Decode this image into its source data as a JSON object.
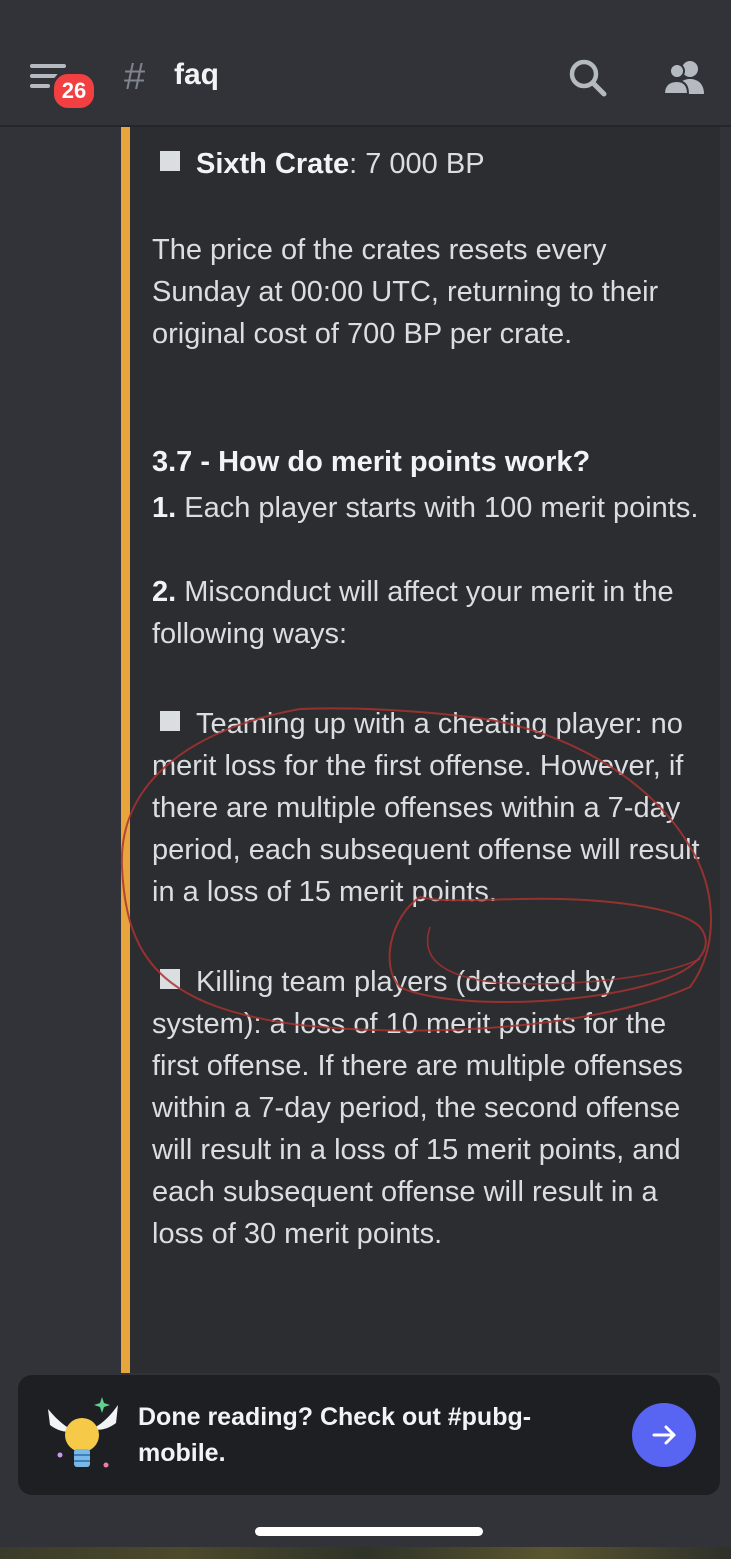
{
  "header": {
    "unread_count": "26",
    "hash_symbol": "#",
    "channel_name": "faq",
    "icons": [
      "menu-icon",
      "search-icon",
      "members-icon"
    ]
  },
  "content": {
    "sixth_crate_label": "Sixth Crate",
    "sixth_crate_value": ": 7 000 BP",
    "reset_text": "The price of the crates resets every Sunday at 00:00 UTC, returning to their original cost of 700 BP per crate.",
    "section_heading": "3.7 - How do merit points work?",
    "point1_num": "1.",
    "point1_text": " Each player starts with 100 merit points.",
    "point2_num": "2.",
    "point2_text": " Misconduct will affect your merit in the following ways:",
    "bullet_teaming": "Teaming up with a cheating player: no merit loss for the first offense. However, if there are multiple offenses within a 7-day period, each subsequent offense will result in a loss of 15 merit points.",
    "bullet_killing": "Killing team players (detected by system): a loss of 10 merit points for the first offense. If there are multiple offenses within a 7-day period, the second offense will result in a loss of 15 merit points, and each subsequent offense will result in a loss of 30 merit points."
  },
  "bottom_card": {
    "text": "Done reading? Check out #pubg-mobile.",
    "button_icon": "arrow-right-icon",
    "mascot_icon": "winged-lightbulb-icon"
  },
  "colors": {
    "background": "#313338",
    "embed_bg": "#2b2d31",
    "embed_accent": "#e8a53d",
    "badge": "#f23f42",
    "button": "#5865f2",
    "annotation": "#a8322f"
  }
}
